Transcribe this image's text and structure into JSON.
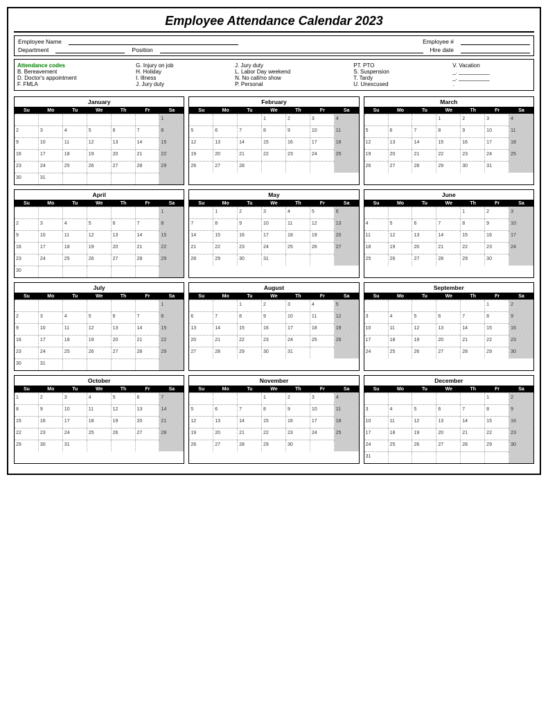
{
  "title": "Employee Attendance Calendar 2023",
  "fields": {
    "employee_name_label": "Employee Name",
    "employee_num_label": "Employee #",
    "department_label": "Department",
    "position_label": "Position",
    "hire_date_label": "Hire date"
  },
  "codes": {
    "title": "Attendance codes",
    "items": [
      "B. Bereavement",
      "D. Doctor's appointment",
      "F.  FMLA"
    ],
    "col2": [
      "G. Injury on job",
      "H. Holiday",
      "I.  Illness",
      "J. Jury duty"
    ],
    "col3": [
      "J. Jury duty",
      "L. Labor Day weekend",
      "N. No call/no show",
      "P. Personal"
    ],
    "col4": [
      "PT. PTO",
      "S. Suspension",
      "T. Tardy",
      "U. Unexcused"
    ],
    "col5": [
      "V. Vacation",
      "_. __________",
      "_. __________",
      "."
    ]
  },
  "months": [
    {
      "name": "January",
      "weeks": [
        [
          null,
          null,
          null,
          null,
          null,
          null,
          1
        ],
        [
          2,
          3,
          4,
          5,
          6,
          7,
          8
        ],
        [
          9,
          10,
          11,
          12,
          13,
          14,
          15
        ],
        [
          16,
          17,
          18,
          19,
          20,
          21,
          22
        ],
        [
          23,
          24,
          25,
          26,
          27,
          28,
          29
        ],
        [
          30,
          31,
          null,
          null,
          null,
          null,
          null
        ]
      ]
    },
    {
      "name": "February",
      "weeks": [
        [
          null,
          null,
          null,
          1,
          2,
          3,
          4
        ],
        [
          5,
          6,
          7,
          8,
          9,
          10,
          11
        ],
        [
          12,
          13,
          14,
          15,
          16,
          17,
          18
        ],
        [
          19,
          20,
          21,
          22,
          23,
          24,
          25
        ],
        [
          26,
          27,
          28,
          null,
          null,
          null,
          null
        ]
      ]
    },
    {
      "name": "March",
      "weeks": [
        [
          null,
          null,
          null,
          1,
          2,
          3,
          4
        ],
        [
          5,
          6,
          7,
          8,
          9,
          10,
          11
        ],
        [
          12,
          13,
          14,
          15,
          16,
          17,
          18
        ],
        [
          19,
          20,
          21,
          22,
          23,
          24,
          25
        ],
        [
          26,
          27,
          28,
          29,
          30,
          31,
          null
        ]
      ]
    },
    {
      "name": "April",
      "weeks": [
        [
          null,
          null,
          null,
          null,
          null,
          null,
          1
        ],
        [
          2,
          3,
          4,
          5,
          6,
          7,
          8
        ],
        [
          9,
          10,
          11,
          12,
          13,
          14,
          15
        ],
        [
          16,
          17,
          18,
          19,
          20,
          21,
          22
        ],
        [
          23,
          24,
          25,
          26,
          27,
          28,
          29
        ],
        [
          30,
          null,
          null,
          null,
          null,
          null,
          null
        ]
      ]
    },
    {
      "name": "May",
      "weeks": [
        [
          null,
          1,
          2,
          3,
          4,
          5,
          6
        ],
        [
          7,
          8,
          9,
          10,
          11,
          12,
          13
        ],
        [
          14,
          15,
          16,
          17,
          18,
          19,
          20
        ],
        [
          21,
          22,
          23,
          24,
          25,
          26,
          27
        ],
        [
          28,
          29,
          30,
          31,
          null,
          null,
          null
        ]
      ]
    },
    {
      "name": "June",
      "weeks": [
        [
          null,
          null,
          null,
          null,
          1,
          2,
          3
        ],
        [
          4,
          5,
          6,
          7,
          8,
          9,
          10
        ],
        [
          11,
          12,
          13,
          14,
          15,
          16,
          17
        ],
        [
          18,
          19,
          20,
          21,
          22,
          23,
          24
        ],
        [
          25,
          26,
          27,
          28,
          29,
          30,
          null
        ]
      ]
    },
    {
      "name": "July",
      "weeks": [
        [
          null,
          null,
          null,
          null,
          null,
          null,
          1
        ],
        [
          2,
          3,
          4,
          5,
          6,
          7,
          8
        ],
        [
          9,
          10,
          11,
          12,
          13,
          14,
          15
        ],
        [
          16,
          17,
          18,
          19,
          20,
          21,
          22
        ],
        [
          23,
          24,
          25,
          26,
          27,
          28,
          29
        ],
        [
          30,
          31,
          null,
          null,
          null,
          null,
          null
        ]
      ]
    },
    {
      "name": "August",
      "weeks": [
        [
          null,
          null,
          1,
          2,
          3,
          4,
          5
        ],
        [
          6,
          7,
          8,
          9,
          10,
          11,
          12
        ],
        [
          13,
          14,
          15,
          16,
          17,
          18,
          19
        ],
        [
          20,
          21,
          22,
          23,
          24,
          25,
          26
        ],
        [
          27,
          28,
          29,
          30,
          31,
          null,
          null
        ]
      ]
    },
    {
      "name": "September",
      "weeks": [
        [
          null,
          null,
          null,
          null,
          null,
          1,
          2
        ],
        [
          3,
          4,
          5,
          6,
          7,
          8,
          9
        ],
        [
          10,
          11,
          12,
          13,
          14,
          15,
          16
        ],
        [
          17,
          18,
          19,
          20,
          21,
          22,
          23
        ],
        [
          24,
          25,
          26,
          27,
          28,
          29,
          30
        ]
      ]
    },
    {
      "name": "October",
      "weeks": [
        [
          1,
          2,
          3,
          4,
          5,
          6,
          7
        ],
        [
          8,
          9,
          10,
          11,
          12,
          13,
          14
        ],
        [
          15,
          16,
          17,
          18,
          19,
          20,
          21
        ],
        [
          22,
          23,
          24,
          25,
          26,
          27,
          28
        ],
        [
          29,
          30,
          31,
          null,
          null,
          null,
          null
        ]
      ]
    },
    {
      "name": "November",
      "weeks": [
        [
          null,
          null,
          null,
          1,
          2,
          3,
          4
        ],
        [
          5,
          6,
          7,
          8,
          9,
          10,
          11
        ],
        [
          12,
          13,
          14,
          15,
          16,
          17,
          18
        ],
        [
          19,
          20,
          21,
          22,
          23,
          24,
          25
        ],
        [
          26,
          27,
          28,
          29,
          30,
          null,
          null
        ]
      ]
    },
    {
      "name": "December",
      "weeks": [
        [
          null,
          null,
          null,
          null,
          null,
          1,
          2
        ],
        [
          3,
          4,
          5,
          6,
          7,
          8,
          9
        ],
        [
          10,
          11,
          12,
          13,
          14,
          15,
          16
        ],
        [
          17,
          18,
          19,
          20,
          21,
          22,
          23
        ],
        [
          24,
          25,
          26,
          27,
          28,
          29,
          30
        ],
        [
          31,
          null,
          null,
          null,
          null,
          null,
          null
        ]
      ]
    }
  ],
  "day_headers": [
    "Su",
    "Mo",
    "Tu",
    "We",
    "Th",
    "Fr",
    "Sa"
  ]
}
